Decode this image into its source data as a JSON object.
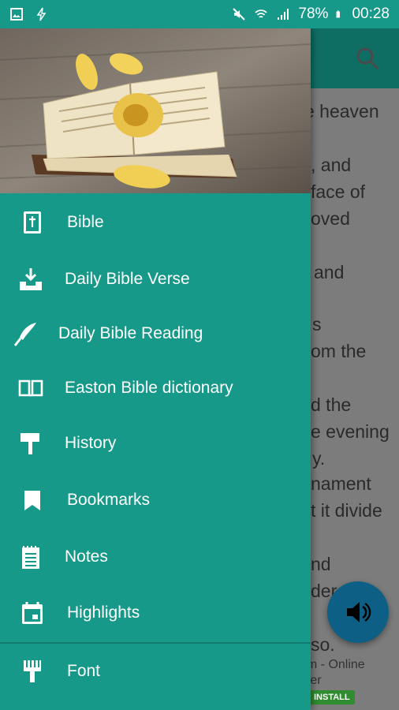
{
  "status_bar": {
    "battery": "78%",
    "time": "00:28"
  },
  "background": {
    "lines": [
      "e heaven",
      ", and",
      "face of",
      "oved",
      "and",
      "s",
      "om the",
      "d the",
      "e evening",
      "y.",
      "nament",
      "t it divide",
      "nd",
      "der th",
      "so."
    ],
    "ad_title": "om - Online",
    "ad_subtitle": "oter",
    "ad_install": "INSTALL"
  },
  "drawer": {
    "items": [
      {
        "label": "Bible",
        "icon": "book-icon"
      },
      {
        "label": "Daily Bible Verse",
        "icon": "download-tray-icon"
      },
      {
        "label": "Daily Bible Reading",
        "icon": "quill-icon"
      },
      {
        "label": "Easton Bible dictionary",
        "icon": "open-book-icon"
      },
      {
        "label": "History",
        "icon": "paint-roller-icon"
      },
      {
        "label": "Bookmarks",
        "icon": "bookmark-icon"
      },
      {
        "label": "Notes",
        "icon": "notepad-icon"
      },
      {
        "label": "Highlights",
        "icon": "calendar-icon"
      },
      {
        "label": "Font",
        "icon": "brush-icon"
      }
    ]
  },
  "colors": {
    "drawer": "#17998a",
    "toolbar": "#0f6e63",
    "fab": "#0e5f85",
    "scrim": "#7c7c7c"
  }
}
